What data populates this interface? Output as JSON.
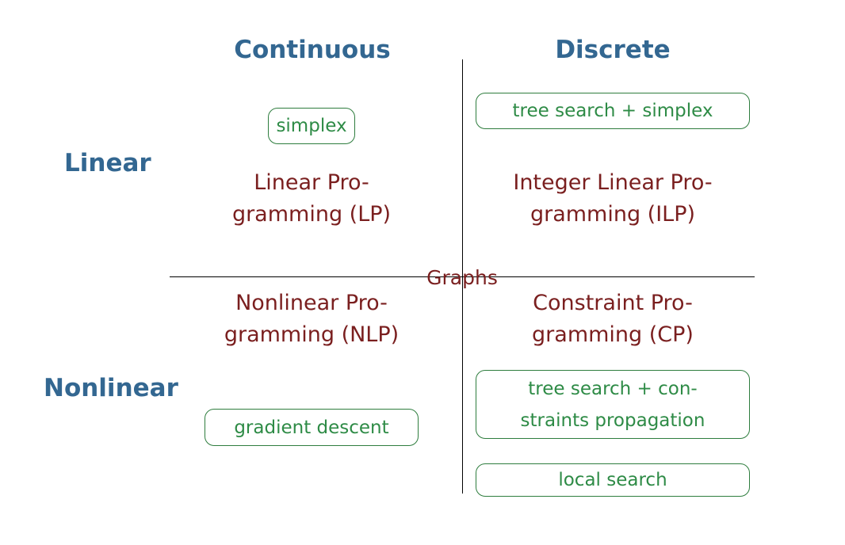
{
  "columns": {
    "continuous": "Continuous",
    "discrete": "Discrete"
  },
  "rows": {
    "linear": "Linear",
    "nonlinear": "Nonlinear"
  },
  "center_label": "Graphs",
  "quadrants": {
    "lp": {
      "line1": "Linear Pro-",
      "line2": "gramming (LP)"
    },
    "ilp": {
      "line1": "Integer Linear Pro-",
      "line2": "gramming (ILP)"
    },
    "nlp": {
      "line1": "Nonlinear Pro-",
      "line2": "gramming (NLP)"
    },
    "cp": {
      "line1": "Constraint Pro-",
      "line2": "gramming (CP)"
    }
  },
  "methods": {
    "simplex": "simplex",
    "tree_search_simplex": "tree search + simplex",
    "gradient_descent": "gradient descent",
    "tree_search_constraints": {
      "line1": "tree search + con-",
      "line2": "straints propagation"
    },
    "local_search": "local search"
  }
}
